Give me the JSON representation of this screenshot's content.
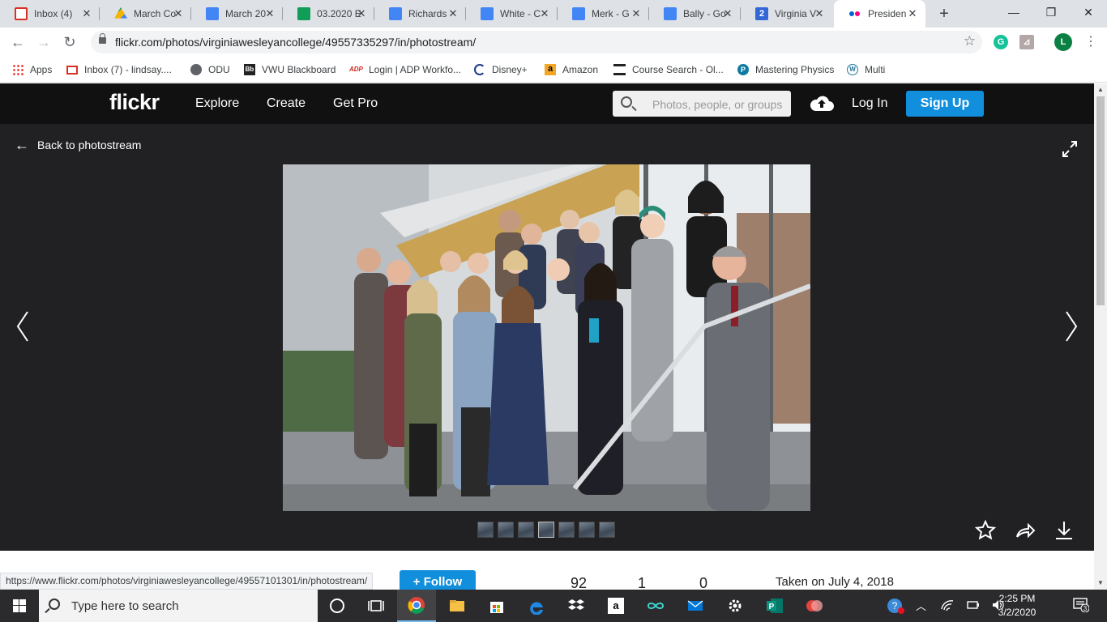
{
  "browser": {
    "tabs": [
      {
        "title": "Inbox (4)",
        "icon": "gmail-icon"
      },
      {
        "title": "March Co",
        "icon": "google-drive-icon"
      },
      {
        "title": "March 20",
        "icon": "google-docs-icon"
      },
      {
        "title": "03.2020 E",
        "icon": "google-sheets-icon"
      },
      {
        "title": "Richards",
        "icon": "google-docs-icon"
      },
      {
        "title": "White - C",
        "icon": "google-docs-icon"
      },
      {
        "title": "Merk - G",
        "icon": "google-docs-icon"
      },
      {
        "title": "Bally - Go",
        "icon": "google-docs-icon"
      },
      {
        "title": "Virginia V",
        "icon": "number-two-icon",
        "icon_text": "2"
      },
      {
        "title": "Presiden",
        "icon": "flickr-icon",
        "active": true
      }
    ],
    "url": "flickr.com/photos/virginiawesleyancollege/49557335297/in/photostream/",
    "profile_initial": "L",
    "bookmarks": [
      {
        "label": "Apps",
        "icon": "apps-grid-icon"
      },
      {
        "label": "Inbox (7) - lindsay....",
        "icon": "gmail-icon"
      },
      {
        "label": "ODU",
        "icon": "globe-icon"
      },
      {
        "label": "VWU Blackboard",
        "icon": "blackboard-icon",
        "icon_text": "Bb"
      },
      {
        "label": "Login | ADP Workfo...",
        "icon": "adp-icon",
        "icon_text": "ADP"
      },
      {
        "label": "Disney+",
        "icon": "disney-icon"
      },
      {
        "label": "Amazon",
        "icon": "amazon-icon",
        "icon_text": "a"
      },
      {
        "label": "Course Search - Ol...",
        "icon": "university-icon"
      },
      {
        "label": "Mastering Physics",
        "icon": "pearson-icon",
        "icon_text": "P"
      },
      {
        "label": "Multi",
        "icon": "wordpress-icon",
        "icon_text": "W"
      }
    ],
    "status_url": "https://www.flickr.com/photos/virginiawesleyancollege/49557101301/in/photostream/"
  },
  "flickr": {
    "logo": "flickr",
    "nav": [
      "Explore",
      "Create",
      "Get Pro"
    ],
    "search_placeholder": "Photos, people, or groups",
    "login": "Log In",
    "signup": "Sign Up",
    "back": "Back to photostream",
    "follow": "Follow",
    "stats": [
      "92",
      "1",
      "0"
    ],
    "taken": "Taken on July 4, 2018"
  },
  "taskbar": {
    "search_text": "Type here to search",
    "time": "2:25 PM",
    "date": "3/2/2020",
    "notification_count": "3"
  },
  "colors": {
    "flickr_blue": "#128fdc",
    "flickr_pink": "#ff0084",
    "page_dark": "#212124",
    "header_black": "#111111"
  }
}
